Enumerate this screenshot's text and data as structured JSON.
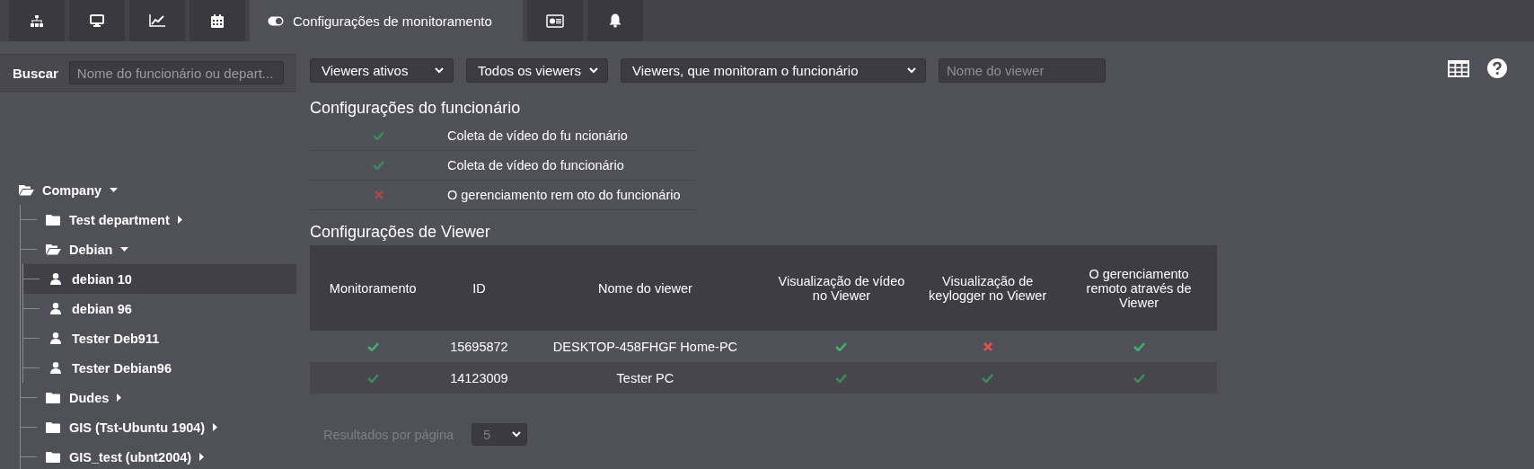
{
  "tabs": [
    {
      "kind": "sitemap",
      "selected": false
    },
    {
      "kind": "monitor",
      "selected": false
    },
    {
      "kind": "chart",
      "selected": false
    },
    {
      "kind": "calendar",
      "selected": false
    },
    {
      "kind": "toggle",
      "label": "Configurações de monitoramento",
      "selected": true
    },
    {
      "kind": "card",
      "selected": false
    },
    {
      "kind": "bell",
      "selected": false
    }
  ],
  "sidebar": {
    "search_label": "Buscar",
    "search_placeholder": "Nome do funcionário ou depart...",
    "tree": [
      {
        "label": "Company",
        "kind": "folder",
        "expanded": true,
        "selected": false,
        "children": [
          {
            "label": "Test department",
            "kind": "folder",
            "expanded": false,
            "selected": false
          },
          {
            "label": "Debian",
            "kind": "folder",
            "expanded": true,
            "selected": false,
            "children": [
              {
                "label": "debian 10",
                "kind": "user",
                "selected": true
              },
              {
                "label": "debian 96",
                "kind": "user",
                "selected": false
              },
              {
                "label": "Tester Deb911",
                "kind": "user",
                "selected": false
              },
              {
                "label": "Tester Debian96",
                "kind": "user",
                "selected": false
              }
            ]
          },
          {
            "label": "Dudes",
            "kind": "folder",
            "expanded": false,
            "selected": false
          },
          {
            "label": "GIS (Tst-Ubuntu 1904)",
            "kind": "folder",
            "expanded": false,
            "selected": false
          },
          {
            "label": "GIS_test (ubnt2004)",
            "kind": "folder",
            "expanded": false,
            "selected": false
          }
        ]
      }
    ]
  },
  "filters": {
    "selects": [
      "Viewers ativos",
      "Todos os viewers",
      "Viewers, que monitoram o funcionário"
    ],
    "viewer_placeholder": "Nome do viewer"
  },
  "employee_settings": {
    "title": "Configurações do funcionário",
    "rows": [
      {
        "enabled": true,
        "label": "Coleta de vídeo do fu ncionário"
      },
      {
        "enabled": true,
        "label": "Coleta de vídeo do funcionário"
      },
      {
        "enabled": false,
        "label": "O gerenciamento rem oto do funcionário"
      }
    ]
  },
  "viewer_settings": {
    "title": "Configurações de Viewer",
    "columns": [
      "Monitoramento",
      "ID",
      "Nome do viewer",
      "Visualização de vídeo no Viewer",
      "Visualização de keylogger no Viewer",
      "O gerenciamento remoto através de Viewer"
    ],
    "rows": [
      {
        "highlighted": true,
        "monitoring": true,
        "id": "15695872",
        "name": "DESKTOP-458FHGF Home-PC",
        "video": true,
        "keylogger": false,
        "remote": true
      },
      {
        "highlighted": false,
        "monitoring": true,
        "id": "14123009",
        "name": "Tester PC",
        "video": true,
        "keylogger": true,
        "remote": true
      }
    ]
  },
  "pagination": {
    "label": "Resultados por página",
    "value": "5"
  }
}
